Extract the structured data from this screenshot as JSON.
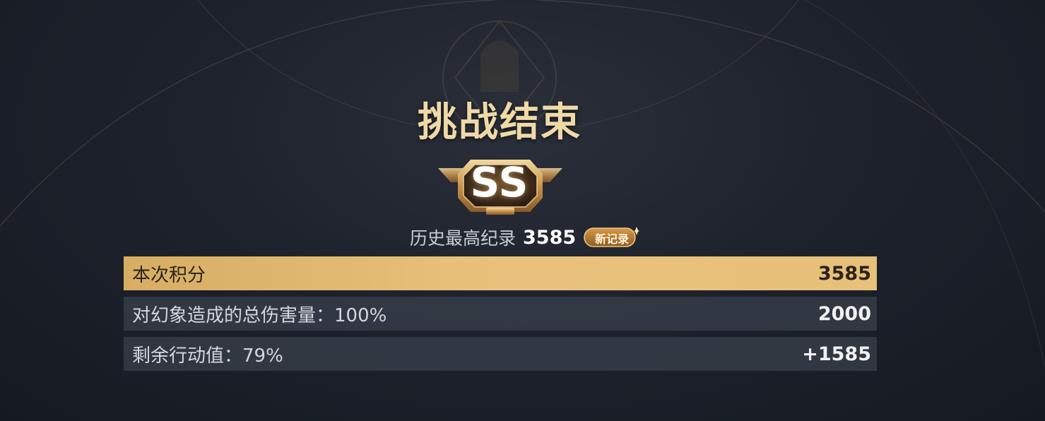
{
  "title": "挑战结束",
  "rank": "SS",
  "record": {
    "label": "历史最高纪录",
    "value": "3585",
    "badge": "新记录"
  },
  "rows": [
    {
      "label": "本次积分",
      "value": "3585",
      "highlighted": true
    },
    {
      "label": "对幻象造成的总伤害量：100%",
      "value": "2000",
      "highlighted": false
    },
    {
      "label": "剩余行动值：79%",
      "value": "+1585",
      "highlighted": false
    }
  ],
  "colors": {
    "accent_gold": "#e3bb73",
    "title_gold": "#efd9a6",
    "background": "#1d222c"
  }
}
